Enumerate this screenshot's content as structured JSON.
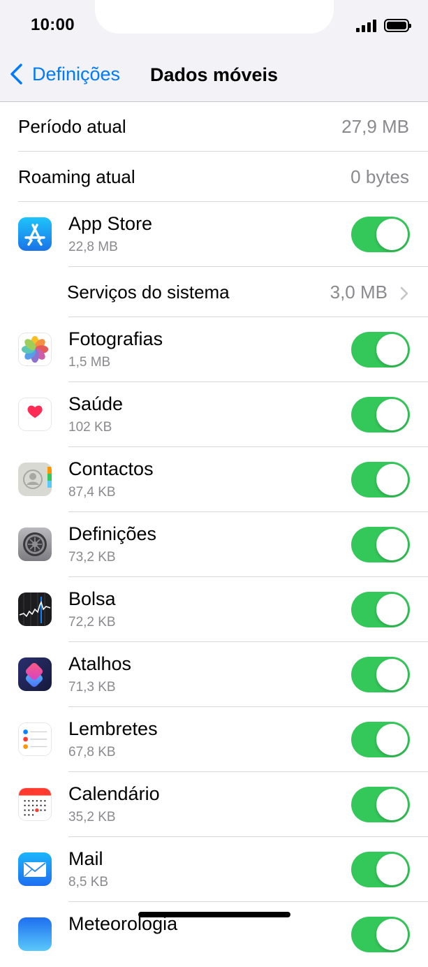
{
  "status": {
    "time": "10:00"
  },
  "nav": {
    "back_label": "Definições",
    "title": "Dados móveis"
  },
  "summary": [
    {
      "label": "Período atual",
      "value": "27,9 MB"
    },
    {
      "label": "Roaming atual",
      "value": "0 bytes"
    }
  ],
  "system_services": {
    "label": "Serviços do sistema",
    "value": "3,0 MB"
  },
  "apps": [
    {
      "name": "App Store",
      "size": "22,8 MB",
      "icon": "app-store-icon",
      "enabled": true
    },
    {
      "name": "Fotografias",
      "size": "1,5 MB",
      "icon": "photos-icon",
      "enabled": true
    },
    {
      "name": "Saúde",
      "size": "102 KB",
      "icon": "health-icon",
      "enabled": true
    },
    {
      "name": "Contactos",
      "size": "87,4 KB",
      "icon": "contacts-icon",
      "enabled": true
    },
    {
      "name": "Definições",
      "size": "73,2 KB",
      "icon": "settings-icon",
      "enabled": true
    },
    {
      "name": "Bolsa",
      "size": "72,2 KB",
      "icon": "stocks-icon",
      "enabled": true
    },
    {
      "name": "Atalhos",
      "size": "71,3 KB",
      "icon": "shortcuts-icon",
      "enabled": true
    },
    {
      "name": "Lembretes",
      "size": "67,8 KB",
      "icon": "reminders-icon",
      "enabled": true
    },
    {
      "name": "Calendário",
      "size": "35,2 KB",
      "icon": "calendar-icon",
      "enabled": true
    },
    {
      "name": "Mail",
      "size": "8,5 KB",
      "icon": "mail-icon",
      "enabled": true
    },
    {
      "name": "Meteorologia",
      "size": "",
      "icon": "weather-icon",
      "enabled": true
    }
  ]
}
